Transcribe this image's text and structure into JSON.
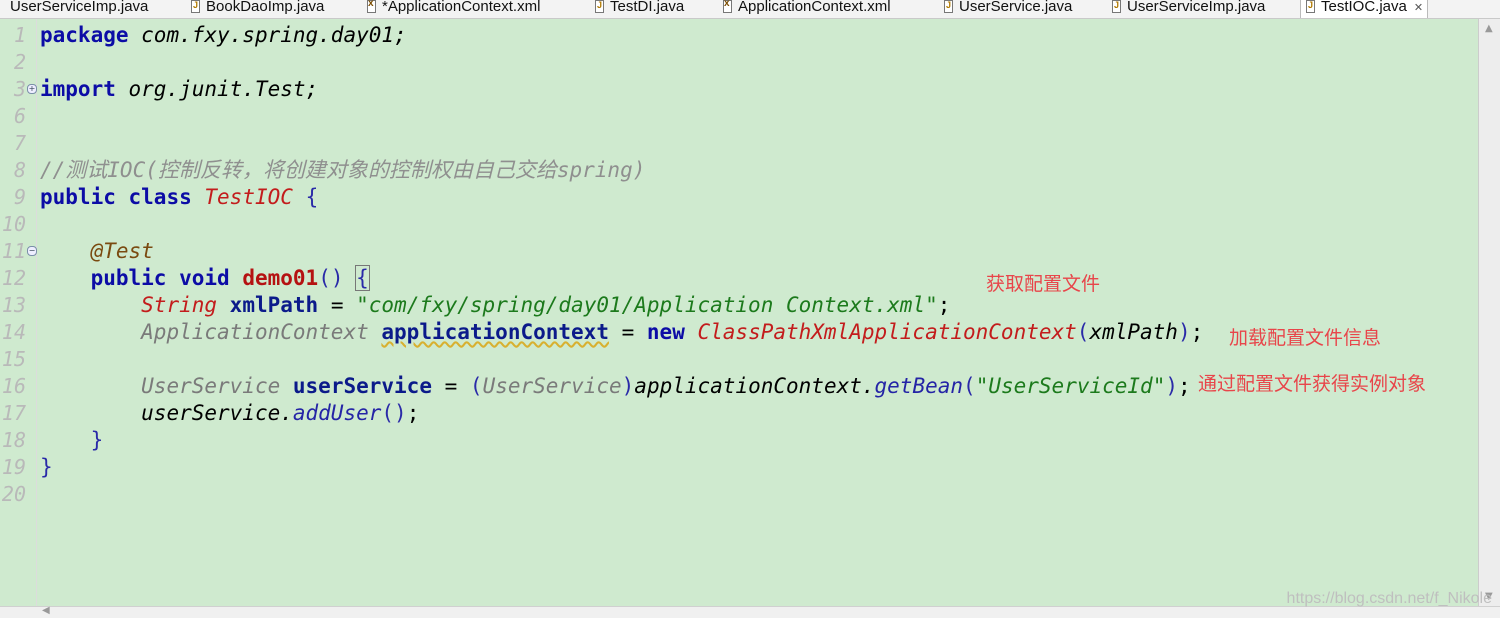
{
  "tabs": [
    {
      "label": "UserServiceImp.java",
      "icon": "java-file-icon"
    },
    {
      "label": "BookDaoImp.java",
      "icon": "java-file-icon"
    },
    {
      "label": "*ApplicationContext.xml",
      "icon": "xml-file-icon"
    },
    {
      "label": "TestDI.java",
      "icon": "java-file-icon"
    },
    {
      "label": "ApplicationContext.xml",
      "icon": "xml-file-icon"
    },
    {
      "label": "UserService.java",
      "icon": "java-file-icon"
    },
    {
      "label": "UserServiceImp.java",
      "icon": "java-file-icon"
    },
    {
      "label": "TestIOC.java",
      "icon": "java-file-icon",
      "active": true
    }
  ],
  "tab_close_glyph": "✕",
  "line_numbers": [
    "1",
    "2",
    "3",
    "6",
    "7",
    "8",
    "9",
    "10",
    "11",
    "12",
    "13",
    "14",
    "15",
    "16",
    "17",
    "18",
    "19",
    "20"
  ],
  "fold_markers": {
    "line3": "+",
    "line11": "−"
  },
  "code": {
    "l1_kw": "package",
    "l1_rest": " com.fxy.spring.day01;",
    "l3_kw": "import",
    "l3_rest": " org.junit.Test;",
    "l8_comment": "//测试IOC(控制反转，将创建对象的控制权由自己交给spring)",
    "l9_kw1": "public",
    "l9_kw2": "class",
    "l9_cls": "TestIOC",
    "l9_brace": "{",
    "l11_ann": "@Test",
    "l12_kw1": "public",
    "l12_kw2": "void",
    "l12_mth": "demo01",
    "l12_paren": "()",
    "l12_brace": "{",
    "l13_type": "String",
    "l13_var": "xmlPath",
    "l13_eq": " = ",
    "l13_str": "\"com/fxy/spring/day01/Application Context.xml\"",
    "l13_end": ";",
    "l14_type": "ApplicationContext",
    "l14_var": "applicationContext",
    "l14_eq": " = ",
    "l14_kw": "new",
    "l14_cls": "ClassPathXmlApplicationContext",
    "l14_open": "(",
    "l14_arg": "xmlPath",
    "l14_close": ")",
    "l14_end": ";",
    "l16_type": "UserService",
    "l16_var": "userService",
    "l16_eq": " = ",
    "l16_cast_open": "(",
    "l16_cast": "UserService",
    "l16_cast_close": ")",
    "l16_obj": "applicationContext.",
    "l16_call": "getBean",
    "l16_open": "(",
    "l16_str": "\"UserServiceId\"",
    "l16_close": ")",
    "l16_end": ";",
    "l17_obj": "userService.",
    "l17_call": "addUser",
    "l17_paren": "()",
    "l17_end": ";",
    "l18": "}",
    "l19": "}"
  },
  "notes": {
    "note1": "获取配置文件",
    "note2": "加载配置文件信息",
    "note3": "通过配置文件获得实例对象"
  },
  "watermark": "https://blog.csdn.net/f_Nikole"
}
